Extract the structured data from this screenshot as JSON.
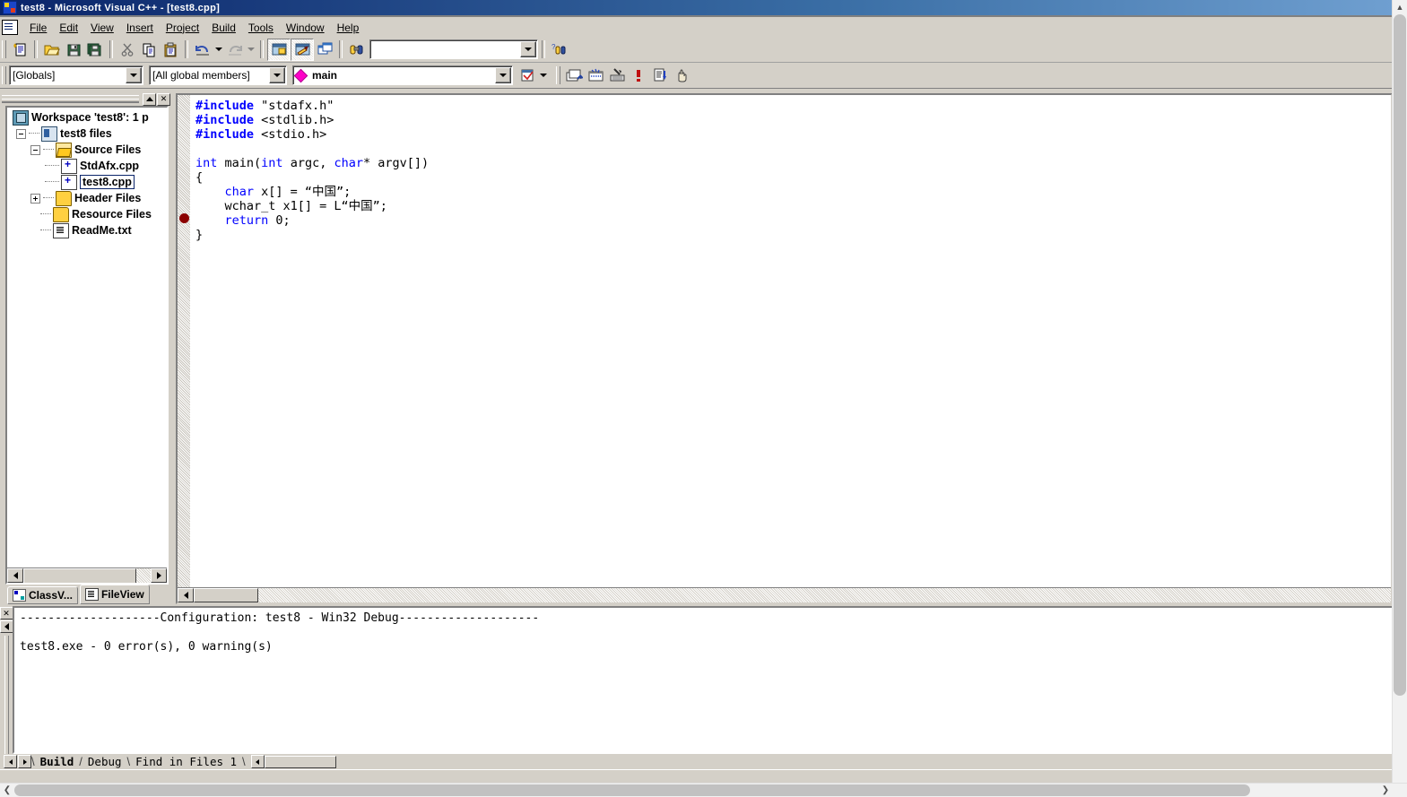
{
  "window": {
    "title": "test8 - Microsoft Visual C++ - [test8.cpp]",
    "app_icon": "vcpp-icon"
  },
  "menubar": {
    "doc_icon": "document-icon",
    "items": [
      {
        "label": "File"
      },
      {
        "label": "Edit"
      },
      {
        "label": "View"
      },
      {
        "label": "Insert"
      },
      {
        "label": "Project"
      },
      {
        "label": "Build"
      },
      {
        "label": "Tools"
      },
      {
        "label": "Window"
      },
      {
        "label": "Help"
      }
    ]
  },
  "toolbar": {
    "buttons": [
      {
        "name": "new-text-file-button",
        "icon": "new-document-icon"
      },
      {
        "name": "open-button",
        "icon": "open-folder-icon"
      },
      {
        "name": "save-button",
        "icon": "floppy-disk-icon"
      },
      {
        "name": "save-all-button",
        "icon": "save-all-icon"
      },
      {
        "name": "cut-button",
        "icon": "scissors-icon"
      },
      {
        "name": "copy-button",
        "icon": "copy-icon"
      },
      {
        "name": "paste-button",
        "icon": "clipboard-icon"
      },
      {
        "name": "undo-button",
        "icon": "undo-arrow-icon"
      },
      {
        "name": "redo-button",
        "icon": "redo-arrow-icon"
      },
      {
        "name": "workspace-toggle-button",
        "icon": "workspace-window-icon"
      },
      {
        "name": "output-toggle-button",
        "icon": "output-window-icon"
      },
      {
        "name": "window-list-button",
        "icon": "cascade-windows-icon"
      },
      {
        "name": "find-in-files-button",
        "icon": "binoculars-icon"
      }
    ],
    "find_box": {
      "value": "",
      "placeholder": ""
    },
    "help_icon": "help-binoculars-icon"
  },
  "wizardbar": {
    "class_combo": {
      "value": "[Globals]"
    },
    "filter_combo": {
      "value": "[All global members]"
    },
    "member_combo": {
      "value": "main",
      "icon": "member-diamond-icon"
    },
    "actions_icon": "wizardbar-actions-icon",
    "right_buttons": [
      {
        "name": "compile-button",
        "icon": "compile-icon"
      },
      {
        "name": "build-button",
        "icon": "build-icon"
      },
      {
        "name": "stop-build-button",
        "icon": "stop-build-icon"
      },
      {
        "name": "execute-program-button",
        "icon": "execute-exclamation-icon"
      },
      {
        "name": "go-button",
        "icon": "go-debug-icon"
      },
      {
        "name": "insert-remove-breakpoint-button",
        "icon": "hand-breakpoint-icon"
      }
    ]
  },
  "workspace": {
    "caption_buttons": [
      {
        "name": "restore-pane-button",
        "glyph": "▲"
      },
      {
        "name": "close-pane-button",
        "glyph": "✕"
      }
    ],
    "tree": [
      {
        "label": "Workspace 'test8': 1 p",
        "icon": "workspace-icon",
        "level": 0,
        "expander": "none",
        "selected": false
      },
      {
        "label": "test8 files",
        "icon": "project-icon",
        "level": 1,
        "expander": "minus",
        "selected": false
      },
      {
        "label": "Source Files",
        "icon": "folder-open-icon",
        "level": 2,
        "expander": "minus",
        "selected": false
      },
      {
        "label": "StdAfx.cpp",
        "icon": "cpp-file-icon",
        "level": 3,
        "expander": "leaf",
        "selected": false
      },
      {
        "label": "test8.cpp",
        "icon": "cpp-file-icon",
        "level": 3,
        "expander": "leaf",
        "selected": true
      },
      {
        "label": "Header Files",
        "icon": "folder-icon",
        "level": 2,
        "expander": "plus",
        "selected": false
      },
      {
        "label": "Resource Files",
        "icon": "folder-icon",
        "level": 2,
        "expander": "leaf",
        "selected": false
      },
      {
        "label": "ReadMe.txt",
        "icon": "text-file-icon",
        "level": 2,
        "expander": "leaf",
        "selected": false
      }
    ],
    "tabs": [
      {
        "label": "ClassV...",
        "icon": "classview-icon",
        "active": false
      },
      {
        "label": "FileView",
        "icon": "fileview-icon",
        "active": true
      }
    ]
  },
  "editor": {
    "filename": "test8.cpp",
    "breakpoint_line": 9,
    "lines": [
      {
        "n": 1,
        "tokens": [
          {
            "t": "#include",
            "c": "pp"
          },
          {
            "t": " \"stdafx.h\"",
            "c": "str"
          }
        ]
      },
      {
        "n": 2,
        "tokens": [
          {
            "t": "#include",
            "c": "pp"
          },
          {
            "t": " <stdlib.h>",
            "c": "str"
          }
        ]
      },
      {
        "n": 3,
        "tokens": [
          {
            "t": "#include",
            "c": "pp"
          },
          {
            "t": " <stdio.h>",
            "c": "str"
          }
        ]
      },
      {
        "n": 4,
        "tokens": []
      },
      {
        "n": 5,
        "tokens": [
          {
            "t": "int",
            "c": "kw"
          },
          {
            "t": " main(",
            "c": ""
          },
          {
            "t": "int",
            "c": "kw"
          },
          {
            "t": " argc, ",
            "c": ""
          },
          {
            "t": "char",
            "c": "kw"
          },
          {
            "t": "* argv[])",
            "c": ""
          }
        ]
      },
      {
        "n": 6,
        "tokens": [
          {
            "t": "{",
            "c": ""
          }
        ]
      },
      {
        "n": 7,
        "tokens": [
          {
            "t": "    ",
            "c": ""
          },
          {
            "t": "char",
            "c": "kw"
          },
          {
            "t": " x[] = “中国”;",
            "c": ""
          }
        ]
      },
      {
        "n": 8,
        "tokens": [
          {
            "t": "    wchar_t x1[] = L“中国”;",
            "c": ""
          }
        ]
      },
      {
        "n": 9,
        "tokens": [
          {
            "t": "    ",
            "c": ""
          },
          {
            "t": "return",
            "c": "kw"
          },
          {
            "t": " 0;",
            "c": ""
          }
        ]
      },
      {
        "n": 10,
        "tokens": [
          {
            "t": "}",
            "c": ""
          }
        ]
      }
    ]
  },
  "output": {
    "close_button_glyph": "✕",
    "scroll_button_glyph": "◄",
    "text": "--------------------Configuration: test8 - Win32 Debug--------------------\n\ntest8.exe - 0 error(s), 0 warning(s)",
    "tabs": [
      {
        "label": "Build",
        "active": true
      },
      {
        "label": "Debug",
        "active": false
      },
      {
        "label": "Find in Files 1",
        "active": false
      }
    ]
  },
  "colors": {
    "titlebar_start": "#0a246a",
    "titlebar_end": "#6f9fd0",
    "face": "#d4d0c8",
    "keyword": "#0000ff",
    "preprocessor": "#0000ff",
    "breakpoint": "#8b0000",
    "selection_border": "#0a246a"
  }
}
